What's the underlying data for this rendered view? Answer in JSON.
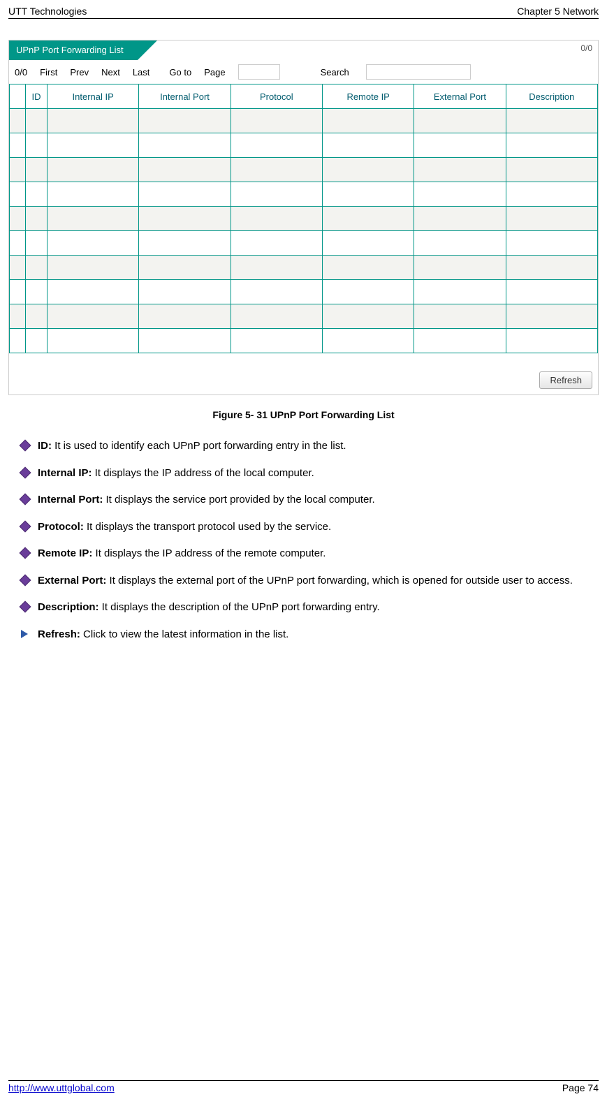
{
  "header": {
    "left": "UTT Technologies",
    "right": "Chapter 5 Network"
  },
  "ui": {
    "tab_title": "UPnP Port Forwarding List",
    "top_count": "0/0",
    "pager": {
      "count": "0/0",
      "first": "First",
      "prev": "Prev",
      "next": "Next",
      "last": "Last",
      "goto": "Go to",
      "page_lbl": "Page",
      "search_lbl": "Search",
      "page_value": "",
      "search_value": ""
    },
    "columns": {
      "id": "ID",
      "internal_ip": "Internal IP",
      "internal_port": "Internal Port",
      "protocol": "Protocol",
      "remote_ip": "Remote IP",
      "external_port": "External Port",
      "description": "Description"
    },
    "refresh": "Refresh"
  },
  "caption": "Figure 5- 31 UPnP Port Forwarding List",
  "bullets": {
    "id_b": "ID:",
    "id_t": " It is used to identify each UPnP port forwarding entry in the list.",
    "iip_b": "Internal IP:",
    "iip_t": " It displays the IP address of the local computer.",
    "iport_b": "Internal Port:",
    "iport_t": " It displays the service port provided by the local computer.",
    "proto_b": "Protocol:",
    "proto_t": " It displays the transport protocol used by the service.",
    "rip_b": "Remote IP:",
    "rip_t": " It displays the IP address of the remote computer.",
    "eport_b": "External Port:",
    "eport_t": " It displays the external port of the UPnP port forwarding, which is opened for outside user to access.",
    "desc_b": "Description:",
    "desc_t": " It displays the description of the UPnP port forwarding entry.",
    "refresh_b": "Refresh:",
    "refresh_t": " Click to view the latest information in the list."
  },
  "footer": {
    "url": "http://www.uttglobal.com",
    "page": "Page 74"
  }
}
